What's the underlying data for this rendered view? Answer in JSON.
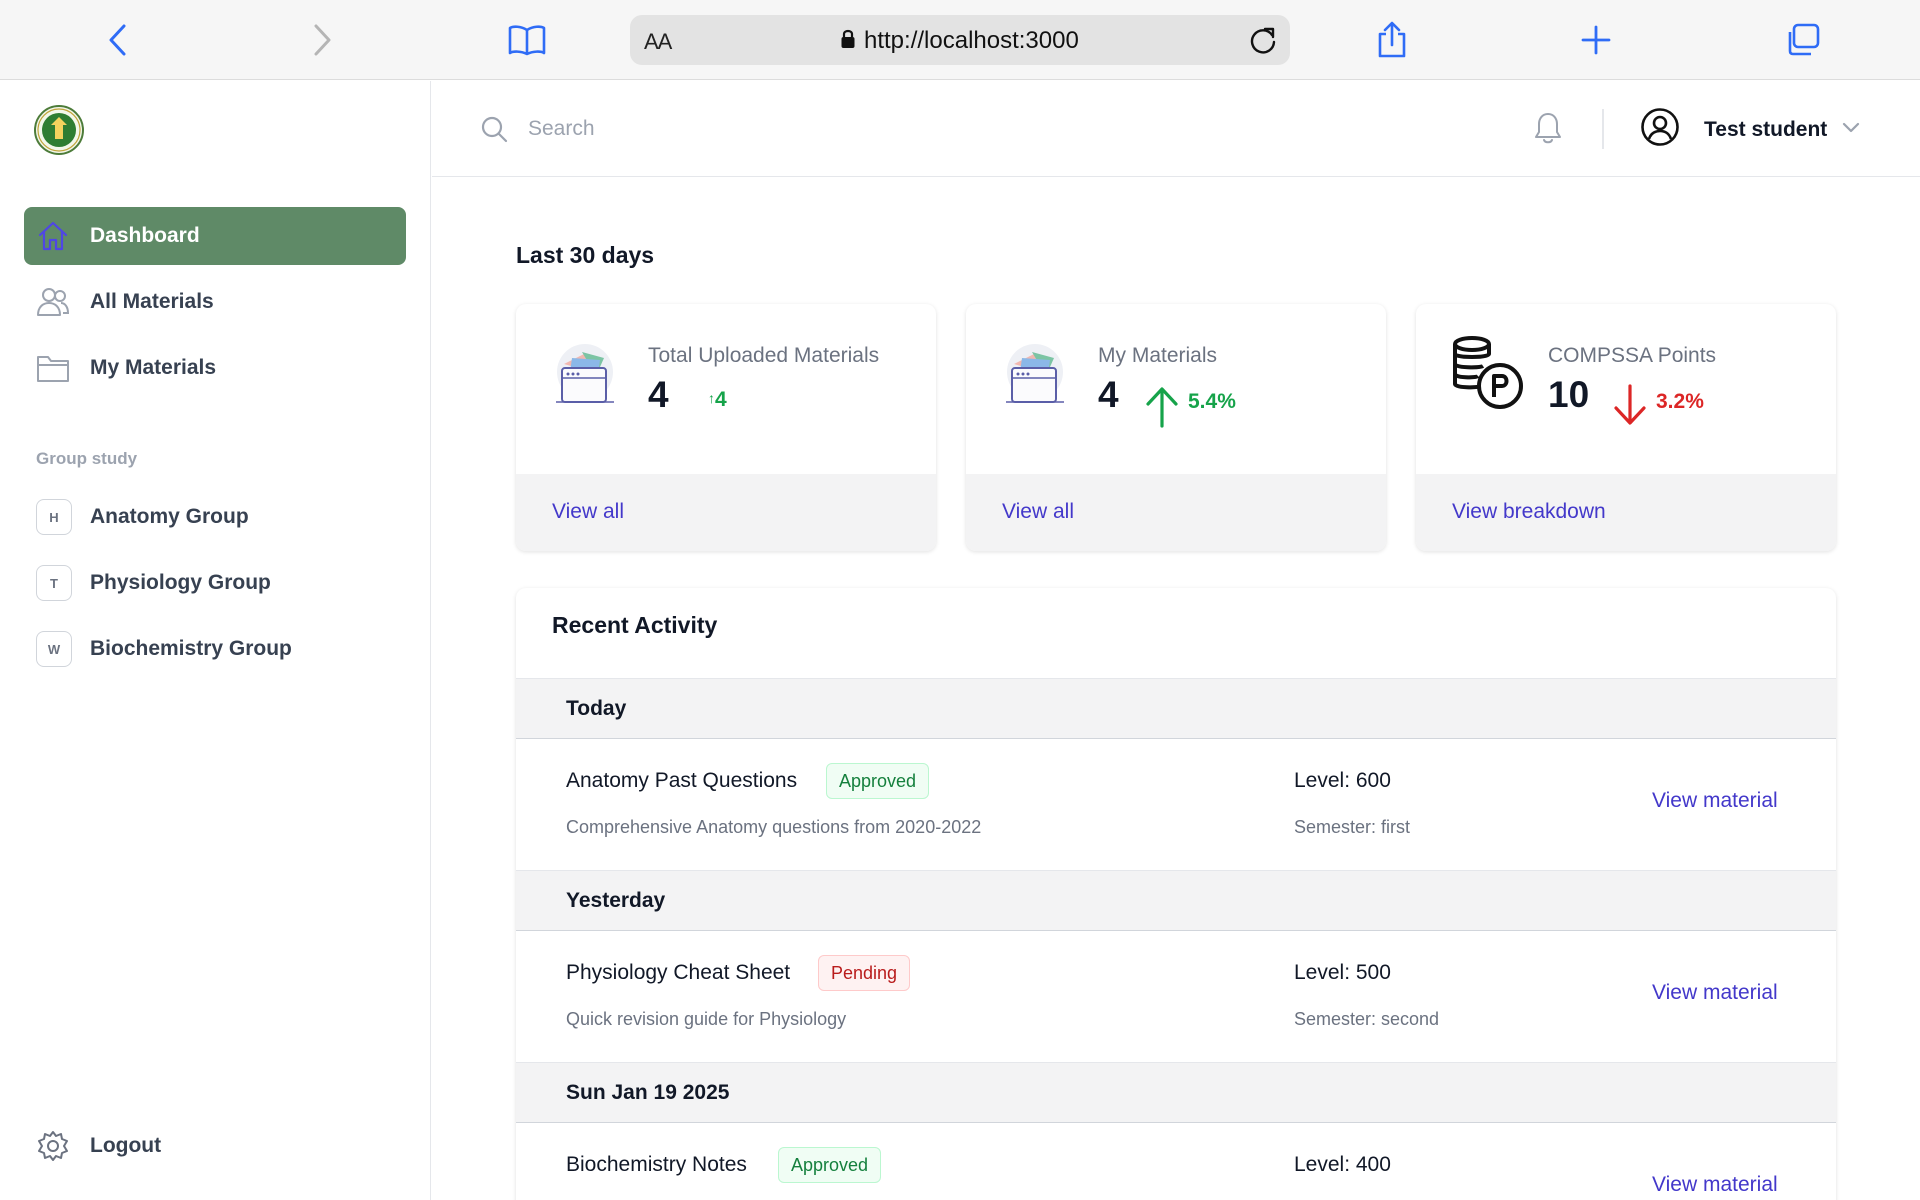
{
  "browser": {
    "aa_label": "AA",
    "url": "http://localhost:3000",
    "icons": [
      "chevron-left-icon",
      "chevron-right-icon",
      "book-icon",
      "lock-icon",
      "reload-icon",
      "share-icon",
      "plus-icon",
      "tabs-icon"
    ]
  },
  "sidebar": {
    "logo": "college-logo",
    "nav": [
      {
        "label": "Dashboard",
        "icon": "home-icon",
        "active": true
      },
      {
        "label": "All Materials",
        "icon": "users-icon",
        "active": false
      },
      {
        "label": "My Materials",
        "icon": "folder-icon",
        "active": false
      }
    ],
    "group_heading": "Group study",
    "groups": [
      {
        "initial": "H",
        "label": "Anatomy Group"
      },
      {
        "initial": "T",
        "label": "Physiology Group"
      },
      {
        "initial": "W",
        "label": "Biochemistry Group"
      }
    ],
    "logout_label": "Logout"
  },
  "topbar": {
    "search_placeholder": "Search",
    "user_name": "Test student"
  },
  "main": {
    "section_title": "Last 30 days",
    "cards": [
      {
        "label": "Total Uploaded Materials",
        "value": "4",
        "change": "4",
        "trend": "up",
        "link": "View all",
        "icon": "materials-illustration-icon"
      },
      {
        "label": "My Materials",
        "value": "4",
        "change": "5.4%",
        "trend": "up",
        "link": "View all",
        "icon": "materials-illustration-icon"
      },
      {
        "label": "COMPSSA Points",
        "value": "10",
        "change": "3.2%",
        "trend": "down",
        "link": "View breakdown",
        "icon": "coins-points-icon"
      }
    ],
    "colors": {
      "up": "#16a34a",
      "down": "#dc2626",
      "accent": "#4338ca",
      "active_nav": "#5f8a67"
    }
  },
  "activity": {
    "title": "Recent Activity",
    "groups": [
      {
        "day": "Today",
        "items": [
          {
            "title": "Anatomy Past Questions",
            "status": "Approved",
            "description": "Comprehensive Anatomy questions from 2020-2022",
            "level": "Level: 600",
            "semester": "Semester: first",
            "link": "View material"
          }
        ]
      },
      {
        "day": "Yesterday",
        "items": [
          {
            "title": "Physiology Cheat Sheet",
            "status": "Pending",
            "description": "Quick revision guide for Physiology",
            "level": "Level: 500",
            "semester": "Semester: second",
            "link": "View material"
          }
        ]
      },
      {
        "day": "Sun Jan 19 2025",
        "items": [
          {
            "title": "Biochemistry Notes",
            "status": "Approved",
            "description": "",
            "level": "Level: 400",
            "semester": "",
            "link": "View material"
          }
        ]
      }
    ]
  }
}
